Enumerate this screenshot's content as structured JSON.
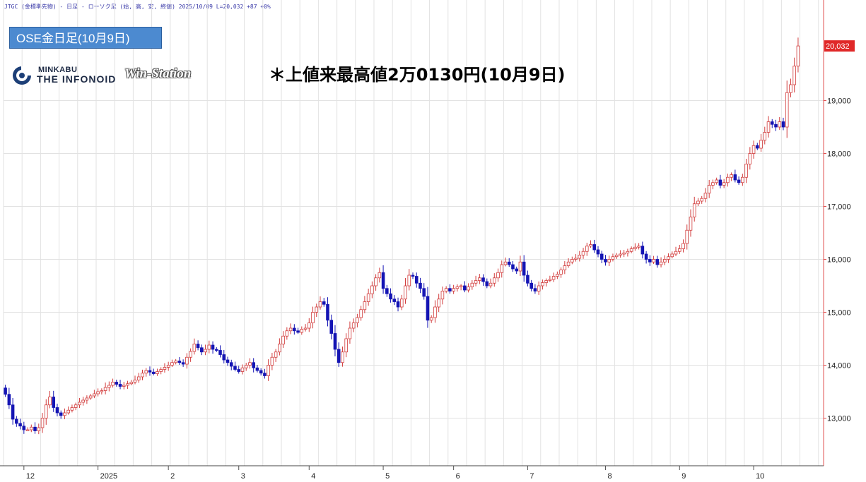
{
  "header": {
    "line": "JTGC (金標準先物) - 日足 - ローソク足 (始, 高, 安, 終値)  2025/10/09 L=20,032 +87 +0%"
  },
  "title_box": {
    "label": "OSE金日足(10月9日)"
  },
  "logo": {
    "top": "MINKABU",
    "bottom": "THE INFONOID",
    "product": "Win-Station"
  },
  "annotation": {
    "text": "＊上値来最高値2万0130円(10月9日)"
  },
  "colors": {
    "up": "#d23b3b",
    "down": "#1414b4",
    "grid": "#e2e2e2",
    "axis": "#e05050",
    "price_tag": "#e02828"
  },
  "chart_data": {
    "type": "candlestick",
    "ylim": [
      12100,
      20900
    ],
    "y_ticks": [
      13000,
      14000,
      15000,
      16000,
      17000,
      18000,
      19000
    ],
    "y_tick_labels": [
      "13,000",
      "14,000",
      "15,000",
      "16,000",
      "17,000",
      "18,000",
      "19,000"
    ],
    "x_tick_labels": [
      {
        "label": "12",
        "index": 5
      },
      {
        "label": "2025",
        "index": 25
      },
      {
        "label": "2",
        "index": 44
      },
      {
        "label": "3",
        "index": 63
      },
      {
        "label": "4",
        "index": 82
      },
      {
        "label": "5",
        "index": 102
      },
      {
        "label": "6",
        "index": 121
      },
      {
        "label": "7",
        "index": 141
      },
      {
        "label": "8",
        "index": 162
      },
      {
        "label": "9",
        "index": 182
      },
      {
        "label": "10",
        "index": 202
      }
    ],
    "last_price_label": "20,032",
    "last_price": 20032,
    "closes": [
      13450,
      13250,
      12980,
      12900,
      12850,
      12780,
      12780,
      12830,
      12760,
      12820,
      13000,
      13250,
      13400,
      13200,
      13100,
      13050,
      13100,
      13150,
      13200,
      13250,
      13300,
      13340,
      13380,
      13420,
      13460,
      13500,
      13520,
      13580,
      13620,
      13680,
      13640,
      13600,
      13620,
      13650,
      13680,
      13720,
      13780,
      13850,
      13900,
      13870,
      13840,
      13880,
      13920,
      13960,
      14000,
      14050,
      14080,
      14050,
      14020,
      14150,
      14260,
      14400,
      14330,
      14250,
      14300,
      14380,
      14300,
      14280,
      14200,
      14100,
      14050,
      13980,
      13920,
      13880,
      13950,
      14000,
      14050,
      13950,
      13900,
      13850,
      13800,
      14000,
      14150,
      14250,
      14400,
      14550,
      14650,
      14700,
      14650,
      14620,
      14680,
      14700,
      14800,
      15000,
      15100,
      15200,
      15150,
      14850,
      14600,
      14300,
      14050,
      14250,
      14500,
      14700,
      14800,
      14900,
      15050,
      15200,
      15350,
      15500,
      15650,
      15750,
      15450,
      15350,
      15250,
      15200,
      15100,
      15250,
      15500,
      15700,
      15680,
      15550,
      15450,
      15300,
      14850,
      14900,
      15100,
      15250,
      15400,
      15450,
      15400,
      15450,
      15480,
      15500,
      15420,
      15480,
      15550,
      15600,
      15650,
      15580,
      15500,
      15550,
      15650,
      15750,
      15900,
      15950,
      15900,
      15820,
      15780,
      15950,
      15700,
      15550,
      15450,
      15400,
      15500,
      15560,
      15600,
      15620,
      15680,
      15720,
      15800,
      15880,
      15950,
      16000,
      16020,
      16080,
      16150,
      16250,
      16280,
      16180,
      16100,
      16000,
      15950,
      16000,
      16050,
      16080,
      16100,
      16120,
      16150,
      16200,
      16230,
      16250,
      16100,
      16000,
      15950,
      16000,
      15900,
      15950,
      16000,
      16050,
      16100,
      16150,
      16200,
      16300,
      16550,
      16800,
      17050,
      17100,
      17150,
      17250,
      17400,
      17450,
      17500,
      17400,
      17450,
      17550,
      17600,
      17500,
      17450,
      17550,
      17800,
      18000,
      18150,
      18100,
      18250,
      18400,
      18600,
      18550,
      18500,
      18600,
      18500,
      19150,
      19300,
      19650,
      20032
    ]
  }
}
